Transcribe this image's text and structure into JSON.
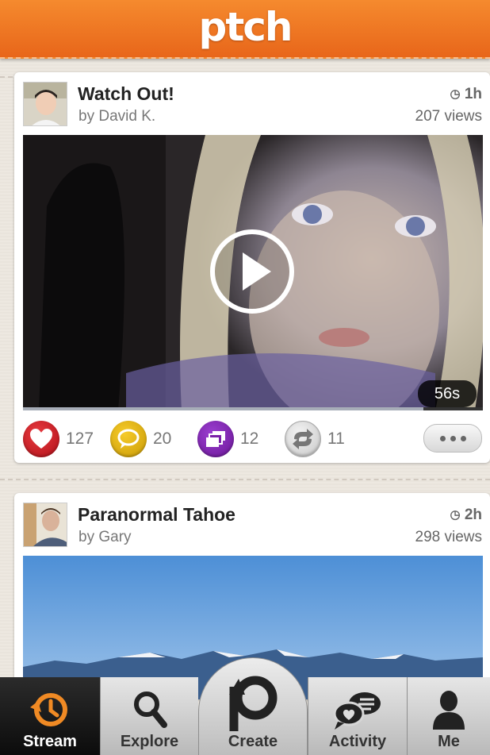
{
  "app": {
    "logo_text": "ptch",
    "brand_color": "#ef7623"
  },
  "posts": [
    {
      "title": "Watch Out!",
      "author": "by David K.",
      "time": "1h",
      "views": "207 views",
      "duration": "56s",
      "progress_fraction": 0.87,
      "likes": "127",
      "comments": "20",
      "remixes": "12",
      "reptches": "11"
    },
    {
      "title": "Paranormal Tahoe",
      "author": "by Gary",
      "time": "2h",
      "views": "298 views"
    }
  ],
  "tabbar": {
    "stream": "Stream",
    "explore": "Explore",
    "create": "Create",
    "activity": "Activity",
    "me": "Me"
  },
  "colors": {
    "like": "#c8141d",
    "comment": "#e2b20a",
    "remix": "#7a1fa8",
    "reptch": "#c9c9c9",
    "active_tab_icon": "#f08a24"
  }
}
